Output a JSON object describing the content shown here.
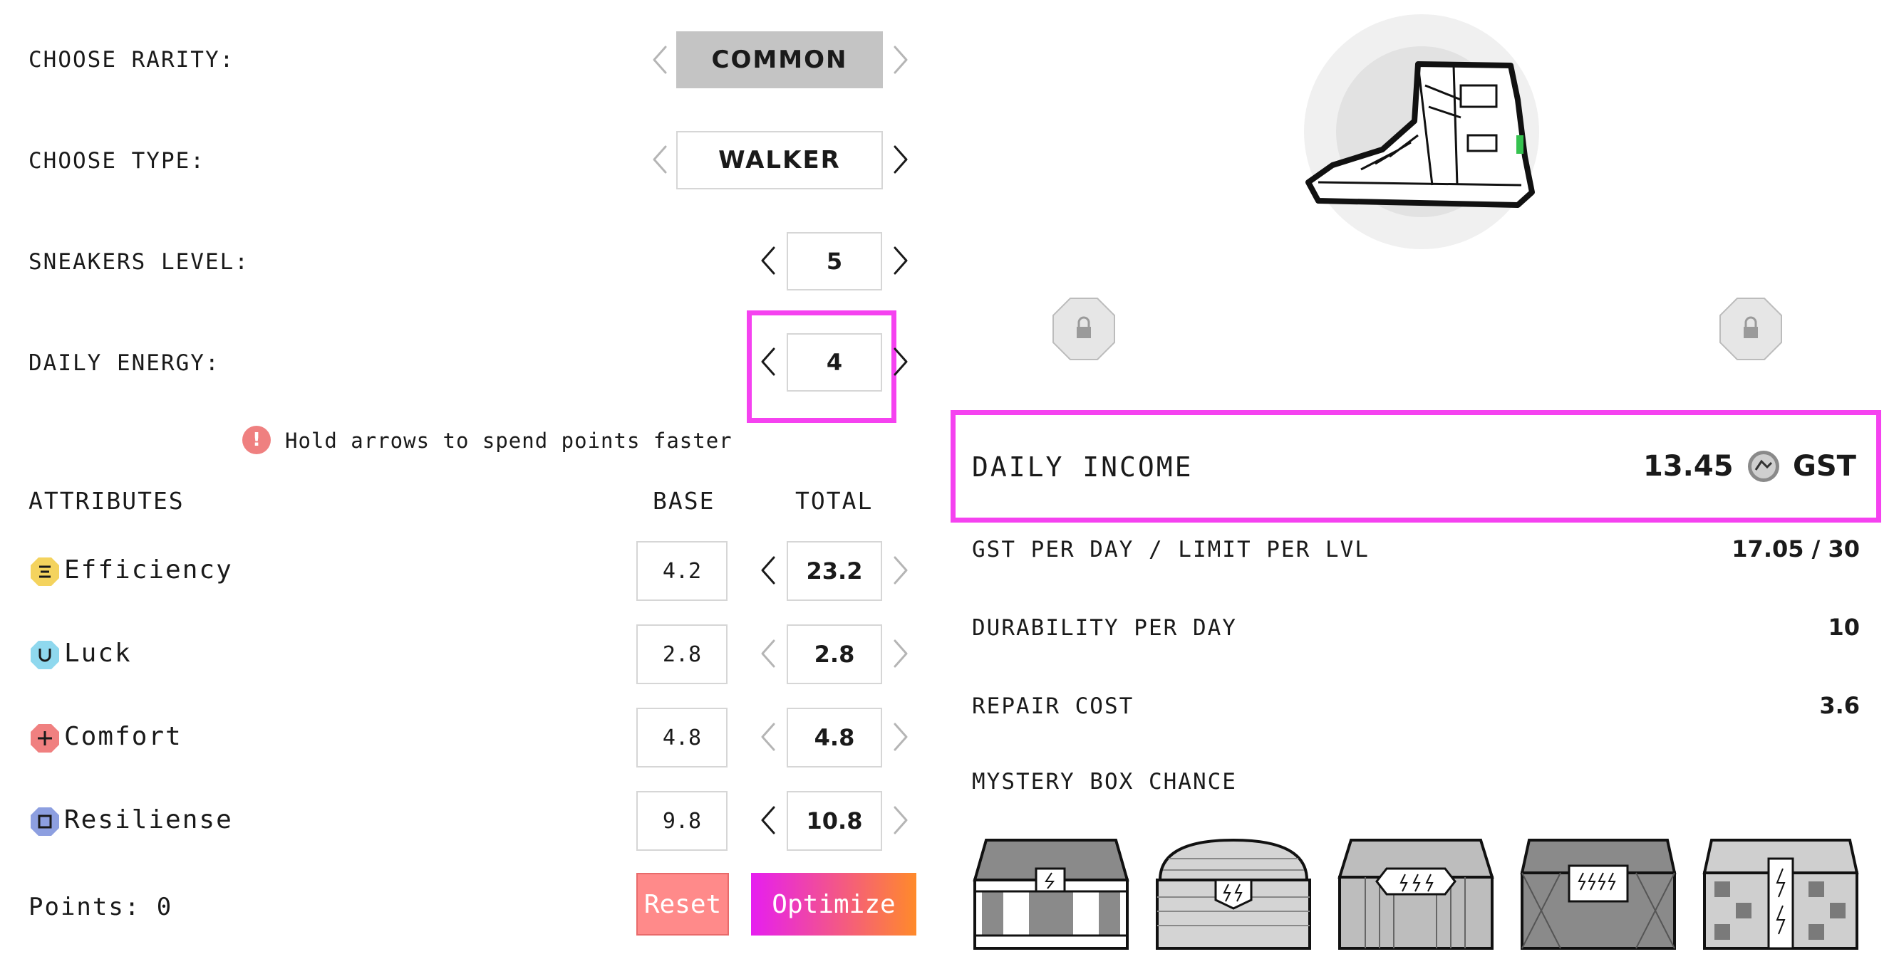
{
  "left": {
    "rarity": {
      "label": "CHOOSE RARITY:",
      "value": "COMMON"
    },
    "type": {
      "label": "CHOOSE TYPE:",
      "value": "WALKER"
    },
    "level": {
      "label": "SNEAKERS LEVEL:",
      "value": "5"
    },
    "energy": {
      "label": "DAILY ENERGY:",
      "value": "4"
    },
    "hint": {
      "icon": "exclamation-icon",
      "text": "Hold arrows to spend points faster"
    },
    "attributes": {
      "heading": "ATTRIBUTES",
      "base_heading": "BASE",
      "total_heading": "TOTAL",
      "items": [
        {
          "name": "Efficiency",
          "icon": "efficiency-icon",
          "color": "#f4d35e",
          "base": "4.2",
          "total": "23.2"
        },
        {
          "name": "Luck",
          "icon": "luck-icon",
          "color": "#8fd8ee",
          "base": "2.8",
          "total": "2.8"
        },
        {
          "name": "Comfort",
          "icon": "comfort-icon",
          "color": "#f08080",
          "base": "4.8",
          "total": "4.8"
        },
        {
          "name": "Resiliense",
          "icon": "resilience-icon",
          "color": "#8d9fe0",
          "base": "9.8",
          "total": "10.8"
        }
      ]
    },
    "points": "Points: 0",
    "reset_label": "Reset",
    "optimize_label": "Optimize"
  },
  "right": {
    "daily_income": {
      "label": "DAILY INCOME",
      "value": "13.45",
      "unit": "GST"
    },
    "stats": [
      {
        "label": "GST PER DAY / LIMIT PER LVL",
        "value": "17.05 / 30"
      },
      {
        "label": "DURABILITY PER DAY",
        "value": "10"
      },
      {
        "label": "REPAIR COST",
        "value": "3.6"
      }
    ],
    "mystery_label": "MYSTERY BOX CHANCE"
  },
  "colors": {
    "highlight": "#f542f0",
    "reset": "#ff8a8a",
    "optimize_start": "#e61ef0",
    "optimize_end": "#ff8a2a",
    "selected_gray": "#c4c4c4"
  }
}
